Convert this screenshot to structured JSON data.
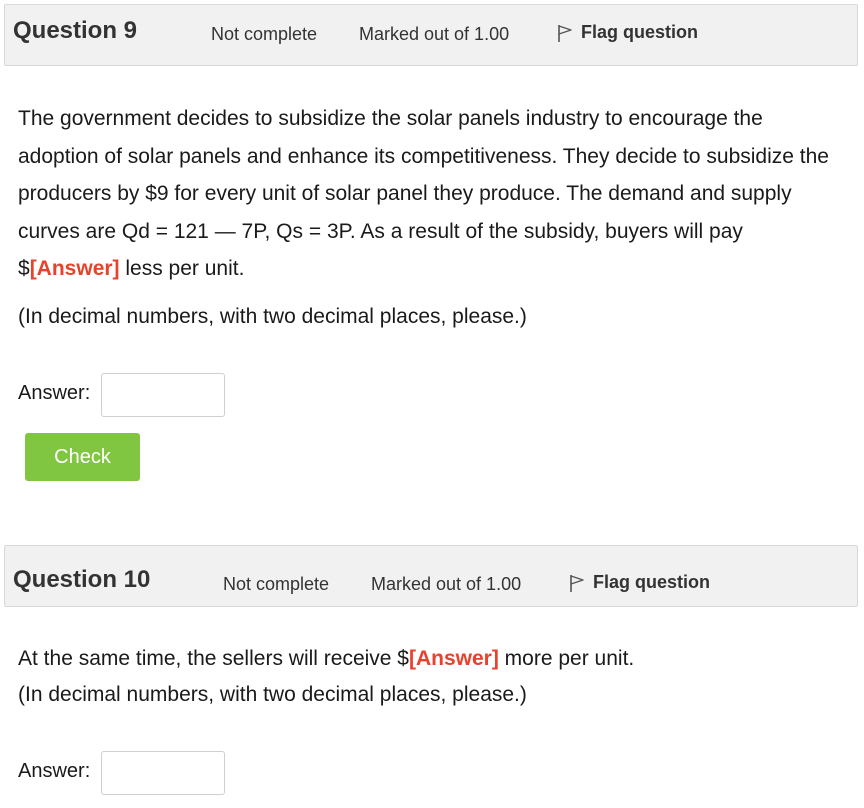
{
  "q9": {
    "title": "Question 9",
    "status": "Not complete",
    "marks": "Marked out of 1.00",
    "flag_label": "Flag question",
    "text_before": "The government decides to subsidize the solar panels industry to encourage the adoption of solar panels and enhance its competitiveness. They decide to subsidize the producers by $9 for every unit of solar panel they produce. The demand and supply curves are Qd = 121 — 7P, Qs = 3P. As a result of the subsidy, buyers will pay $",
    "answer_tag": "[Answer]",
    "text_after": " less per unit.",
    "note": "(In decimal numbers, with two decimal places, please.)",
    "answer_label": "Answer:",
    "answer_value": "",
    "check_label": "Check"
  },
  "q10": {
    "title": "Question 10",
    "status": "Not complete",
    "marks": "Marked out of 1.00",
    "flag_label": "Flag question",
    "text_before": "At the same time, the sellers will receive $",
    "answer_tag": "[Answer]",
    "text_after": " more per unit.",
    "note": "(In decimal numbers, with two decimal places, please.)",
    "answer_label": "Answer:",
    "answer_value": ""
  },
  "colors": {
    "accent_red": "#e8412c",
    "check_green": "#80c640",
    "header_bg": "#f1f1f1"
  },
  "icons": {
    "flag": "flag-outline-icon"
  }
}
